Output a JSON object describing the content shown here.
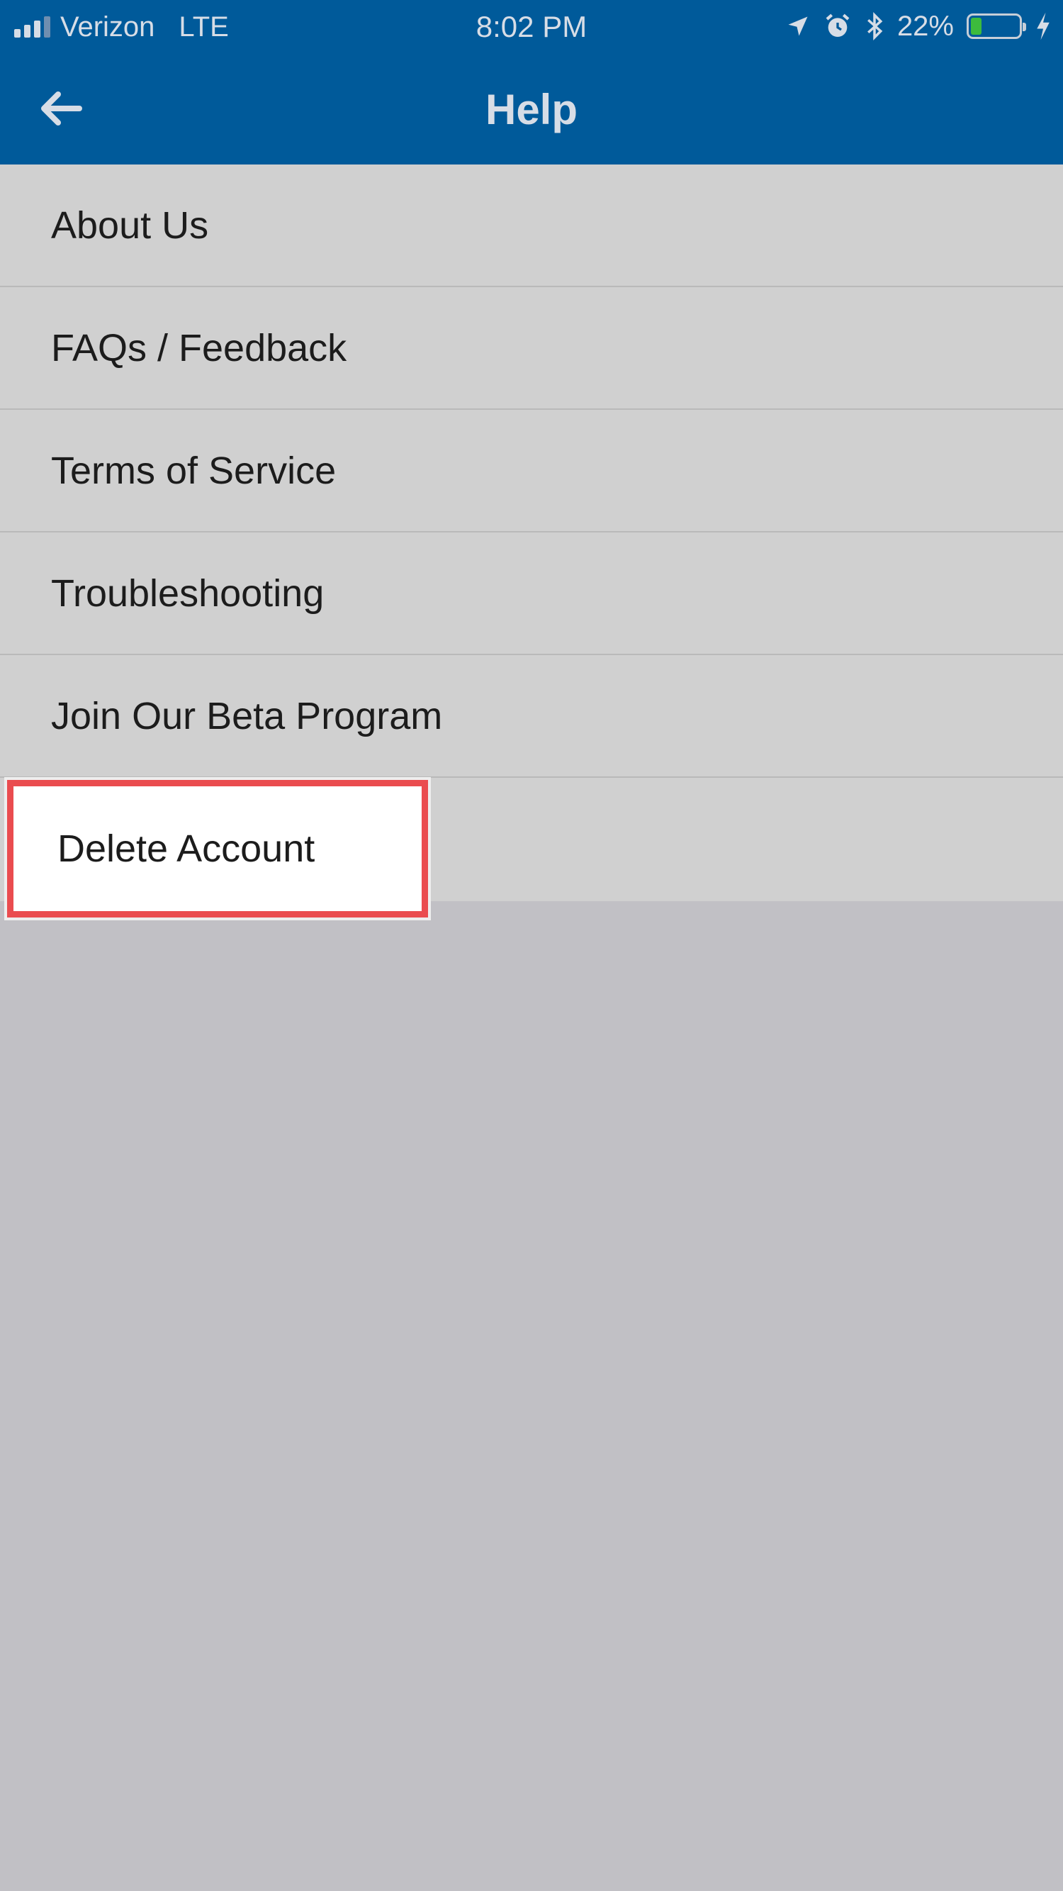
{
  "status_bar": {
    "carrier": "Verizon",
    "network": "LTE",
    "time": "8:02 PM",
    "battery_percent": "22%",
    "battery_level": 0.22,
    "icons": [
      "signal-icon",
      "location-arrow-icon",
      "alarm-icon",
      "bluetooth-icon",
      "battery-icon",
      "charging-bolt-icon"
    ]
  },
  "header": {
    "title": "Help",
    "back_icon": "back-arrow-icon",
    "background_color": "#005a9a"
  },
  "menu": {
    "items": [
      {
        "label": "About Us"
      },
      {
        "label": "FAQs / Feedback"
      },
      {
        "label": "Terms of Service"
      },
      {
        "label": "Troubleshooting"
      },
      {
        "label": "Join Our Beta Program"
      },
      {
        "label": "Delete Account"
      }
    ]
  },
  "highlight": {
    "target": "Delete Account",
    "color": "#ea4c4f"
  }
}
